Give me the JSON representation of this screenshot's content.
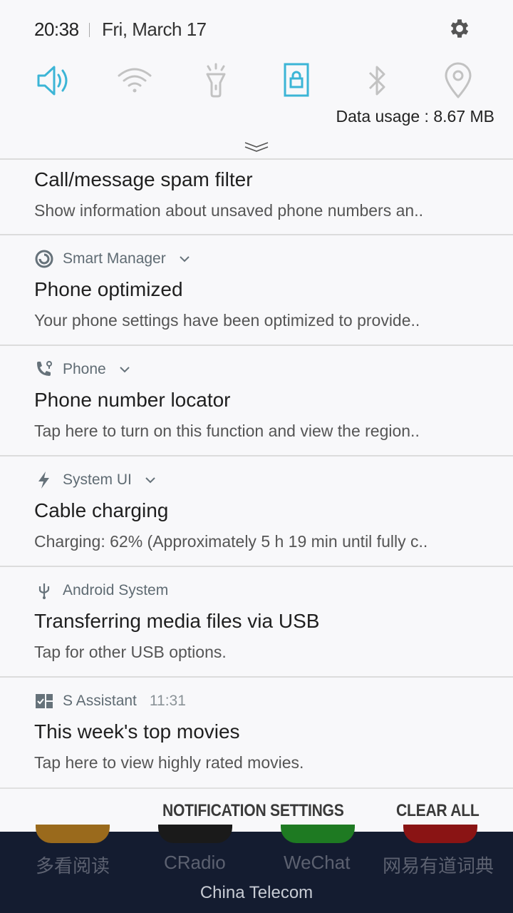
{
  "status": {
    "time": "20:38",
    "date": "Fri, March 17",
    "data_usage": "Data usage : 8.67 MB"
  },
  "quick_settings": [
    {
      "name": "sound",
      "icon": "volume-icon",
      "active": true
    },
    {
      "name": "wifi",
      "icon": "wifi-icon",
      "active": false
    },
    {
      "name": "flashlight",
      "icon": "flashlight-icon",
      "active": false
    },
    {
      "name": "rotation-lock",
      "icon": "screen-lock-icon",
      "active": true
    },
    {
      "name": "bluetooth",
      "icon": "bluetooth-icon",
      "active": false
    },
    {
      "name": "location",
      "icon": "location-icon",
      "active": false
    }
  ],
  "colors": {
    "accent": "#3cb5d6",
    "inactive": "#bdbdbd",
    "panel_bg": "#f8f8fa",
    "home_bg": "#141c30"
  },
  "notifications": [
    {
      "app": "",
      "title": "Call/message spam filter",
      "body": "Show information about unsaved phone numbers an.."
    },
    {
      "app": "Smart Manager",
      "icon": "smart-manager-icon",
      "expandable": true,
      "title": "Phone optimized",
      "body": "Your phone settings have been optimized to provide.."
    },
    {
      "app": "Phone",
      "icon": "phone-locator-icon",
      "expandable": true,
      "title": "Phone number locator",
      "body": "Tap here to turn on this function and view the region.."
    },
    {
      "app": "System UI",
      "icon": "lightning-icon",
      "expandable": true,
      "title": "Cable charging",
      "body": "Charging: 62% (Approximately 5 h 19 min until fully c.."
    },
    {
      "app": "Android System",
      "icon": "usb-icon",
      "expandable": false,
      "title": "Transferring media files via USB",
      "body": "Tap for other USB options."
    },
    {
      "app": "S Assistant",
      "icon": "s-assistant-icon",
      "time": "11:31",
      "expandable": false,
      "title": "This week's top movies",
      "body": "Tap here to view highly rated movies."
    }
  ],
  "actions": {
    "notification_settings": "NOTIFICATION SETTINGS",
    "clear_all": "CLEAR ALL"
  },
  "home": {
    "apps": [
      {
        "label": "多看阅读",
        "color": "#9a6a1c"
      },
      {
        "label": "CRadio",
        "color": "#1a1a1a"
      },
      {
        "label": "WeChat",
        "color": "#1e7a22"
      },
      {
        "label": "网易有道词典",
        "color": "#8a1414"
      }
    ],
    "carrier": "China Telecom"
  }
}
